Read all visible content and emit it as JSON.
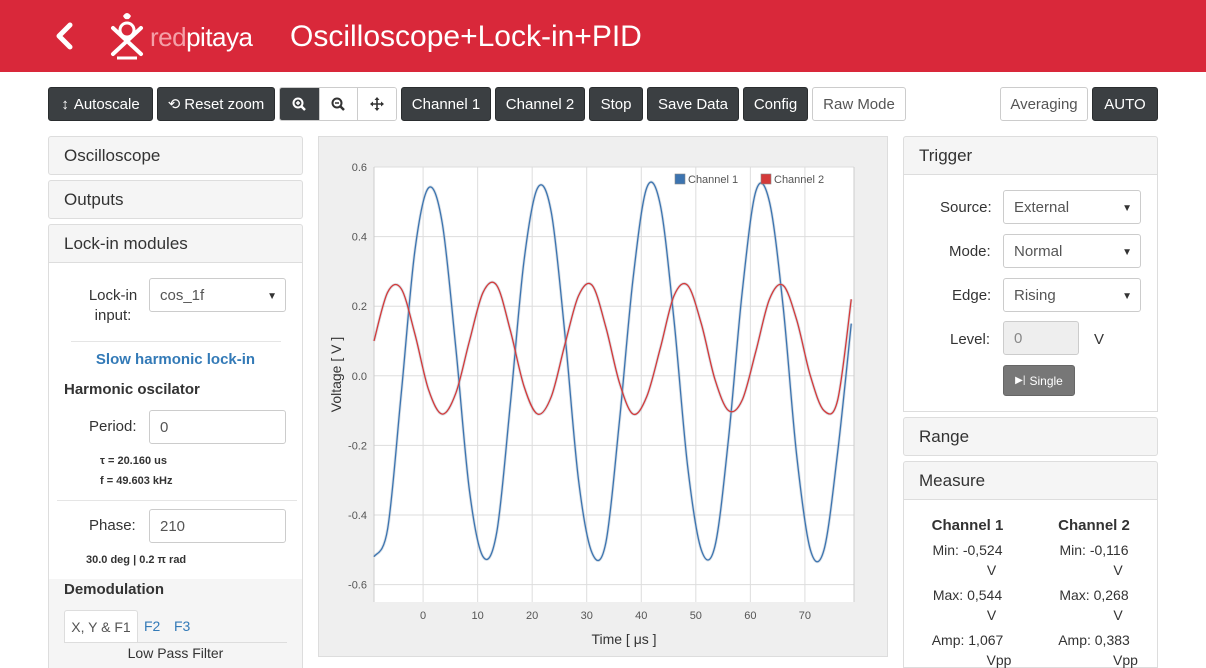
{
  "header": {
    "logo_text_red": "red",
    "logo_text_white": "pitaya",
    "title": "Oscilloscope+Lock-in+PID"
  },
  "toolbar": {
    "autoscale": "Autoscale",
    "reset_zoom": "Reset zoom",
    "channel1": "Channel 1",
    "channel2": "Channel 2",
    "stop": "Stop",
    "save_data": "Save Data",
    "config": "Config",
    "raw_mode": "Raw Mode",
    "averaging": "Averaging",
    "auto": "AUTO"
  },
  "left": {
    "oscilloscope": "Oscilloscope",
    "outputs": "Outputs",
    "lockin_modules": "Lock-in modules",
    "lockin_input_label1": "Lock-in",
    "lockin_input_label2": "input:",
    "lockin_input_value": "cos_1f",
    "slow_harmonic": "Slow harmonic lock-in",
    "harmonic_oscilator": "Harmonic oscilator",
    "period_label": "Period:",
    "period_value": "0",
    "tau": "τ = 20.160 us",
    "freq": "f = 49.603 kHz",
    "phase_label": "Phase:",
    "phase_value": "210",
    "phase_info": "30.0 deg | 0.2 π rad",
    "demodulation": "Demodulation",
    "tabs": [
      "X, Y & F1",
      "F2",
      "F3"
    ],
    "low_pass": "Low Pass Filter"
  },
  "right": {
    "trigger": "Trigger",
    "source_label": "Source:",
    "source_value": "External",
    "mode_label": "Mode:",
    "mode_value": "Normal",
    "edge_label": "Edge:",
    "edge_value": "Rising",
    "level_label": "Level:",
    "level_value": "0",
    "level_unit": "V",
    "single": "Single",
    "range": "Range",
    "measure": "Measure",
    "ch1": {
      "name": "Channel 1",
      "min_label": "Min:",
      "min": "-0,524",
      "max_label": "Max:",
      "max": "0,544",
      "amp_label": "Amp:",
      "amp": "1,067",
      "unit_v": "V",
      "unit_vpp": "Vpp"
    },
    "ch2": {
      "name": "Channel 2",
      "min_label": "Min:",
      "min": "-0,116",
      "max_label": "Max:",
      "max": "0,268",
      "amp_label": "Amp:",
      "amp": "0,383",
      "unit_v": "V",
      "unit_vpp": "Vpp"
    }
  },
  "colors": {
    "brand_red": "#d9283a",
    "ch1": "#3c74b0",
    "ch2": "#d43a3a"
  },
  "chart_data": {
    "type": "line",
    "xlabel": "Time [ μs ]",
    "ylabel": "Voltage [ V ]",
    "xlim": [
      -9,
      79
    ],
    "ylim": [
      -0.65,
      0.6
    ],
    "xticks": [
      0,
      10,
      20,
      30,
      40,
      50,
      60,
      70
    ],
    "xtick_labels": [
      "0",
      "10",
      "20",
      "30",
      "40",
      "50",
      "60",
      "70"
    ],
    "yticks": [
      0.6,
      0.4,
      0.2,
      0.0,
      -0.2,
      -0.4,
      -0.6
    ],
    "ytick_labels": [
      "0.6",
      "0.4",
      "0.2",
      "0.0",
      "-0.2",
      "-0.4",
      "-0.6"
    ],
    "legend_position": "top-right",
    "series": [
      {
        "name": "Channel 1",
        "color": "#3c74b0",
        "x": [
          -9,
          -6.5,
          -4,
          -1.5,
          1,
          3.5,
          6,
          8.5,
          11,
          13.5,
          16,
          18.5,
          21,
          23.5,
          26,
          28.5,
          31,
          33.5,
          36,
          38.5,
          41,
          43.5,
          46,
          48.5,
          51,
          53.5,
          56,
          58.5,
          61,
          63.5,
          66,
          68.5,
          71,
          73.5,
          76,
          78.5
        ],
        "y": [
          -0.52,
          -0.44,
          -0.05,
          0.36,
          0.54,
          0.44,
          0.08,
          -0.33,
          -0.52,
          -0.45,
          -0.08,
          0.33,
          0.54,
          0.47,
          0.12,
          -0.3,
          -0.51,
          -0.48,
          -0.13,
          0.28,
          0.54,
          0.49,
          0.16,
          -0.26,
          -0.5,
          -0.49,
          -0.18,
          0.24,
          0.53,
          0.5,
          0.2,
          -0.23,
          -0.5,
          -0.5,
          -0.22,
          0.15
        ]
      },
      {
        "name": "Channel 2",
        "color": "#d43a3a",
        "x": [
          -9,
          -6.5,
          -4,
          -1.5,
          1,
          3.5,
          6,
          8.5,
          11,
          13.5,
          16,
          18.5,
          21,
          23.5,
          26,
          28.5,
          31,
          33.5,
          36,
          38.5,
          41,
          43.5,
          46,
          48.5,
          51,
          53.5,
          56,
          58.5,
          61,
          63.5,
          66,
          68.5,
          71,
          73.5,
          76,
          78.5
        ],
        "y": [
          0.1,
          0.24,
          0.25,
          0.12,
          -0.04,
          -0.11,
          -0.05,
          0.1,
          0.24,
          0.26,
          0.13,
          -0.03,
          -0.11,
          -0.06,
          0.09,
          0.23,
          0.26,
          0.14,
          -0.02,
          -0.11,
          -0.06,
          0.08,
          0.23,
          0.26,
          0.15,
          -0.01,
          -0.1,
          -0.07,
          0.07,
          0.22,
          0.26,
          0.16,
          0.0,
          -0.1,
          -0.07,
          0.22
        ]
      }
    ]
  }
}
